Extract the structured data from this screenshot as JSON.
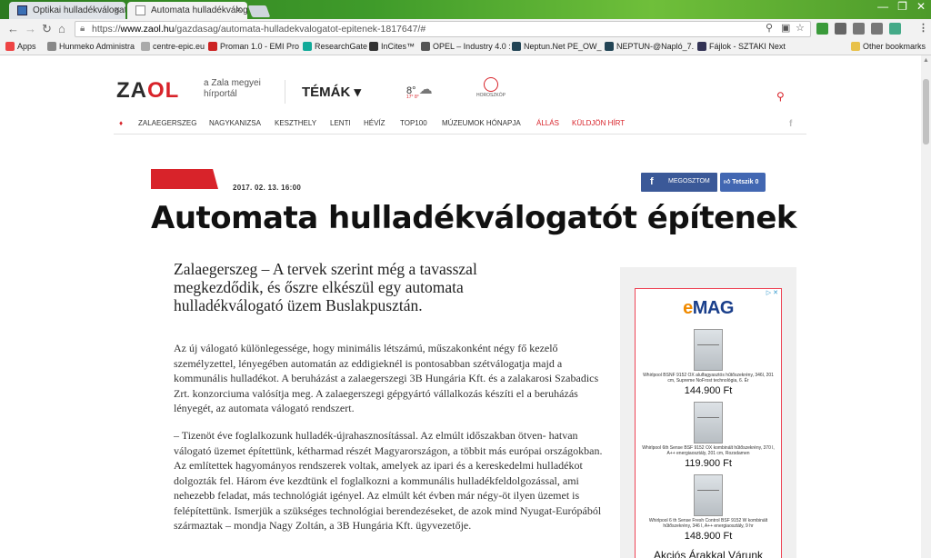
{
  "browser": {
    "tabs": [
      {
        "title": "Optikai hulladékválogató",
        "active": false
      },
      {
        "title": "Automata hulladékválogató",
        "active": true
      }
    ],
    "url_prefix": "https://",
    "url_host": "www.zaol.hu",
    "url_path": "/gazdasag/automata-hulladekvalogatot-epitenek-1817647/#",
    "bookmarks": [
      "Apps",
      "Hunmeko Administra",
      "centre-epic.eu",
      "Proman 1.0 - EMI Pro",
      "ResearchGate",
      "InCites™",
      "OPEL – Industry 4.0 :",
      "Neptun.Net PE_OW_",
      "NEPTUN-@Napló_7.",
      "Fájlok - SZTAKI Next",
      "Other bookmarks"
    ]
  },
  "site": {
    "logo_main": "ZA",
    "logo_accent": "OL",
    "tagline": "a Zala megyei hírportál",
    "topics_label": "TÉMÁK ▾",
    "temperature": "8°",
    "temp_range": "17° 8°",
    "horoscope_label": "HOROSZKÓP",
    "nav": [
      {
        "label": "ZALAEGERSZEG",
        "hot": false
      },
      {
        "label": "NAGYKANIZSA",
        "hot": false
      },
      {
        "label": "KESZTHELY",
        "hot": false
      },
      {
        "label": "LENTI",
        "hot": false
      },
      {
        "label": "HÉVÍZ",
        "hot": false
      },
      {
        "label": "TOP100",
        "hot": false
      },
      {
        "label": "MÚZEUMOK HÓNAPJA",
        "hot": false
      },
      {
        "label": "ÁLLÁS",
        "hot": true
      },
      {
        "label": "KÜLDJÖN HÍRT",
        "hot": true
      }
    ]
  },
  "article": {
    "date": "2017. 02. 13. 16:00",
    "share_label": "MEGOSZTOM",
    "like_label": "Tetszik 0",
    "title": "Automata hulladékválogatót építenek",
    "lead": "Zalaegerszeg – A tervek szerint még a tavasszal megkezdődik, és őszre elkészül egy automata hulladékválogató üzem Buslakpusztán.",
    "paragraphs": [
      "Az új válogató különlegessége, hogy minimális létszámú, műszakonként négy fő kezelő személyzettel, lényegében automatán az eddigieknél is pontosabban szétválogatja majd a kommunális hulladékot. A beruházást a zalaegerszegi 3B Hungária Kft. és a zalakarosi Szabadics Zrt. konzorciuma valósítja meg. A zalaegerszegi gépgyártó vállalkozás készíti el a beruházás lényegét, az automata válogató rendszert.",
      "– Tizenöt éve foglalkozunk hulladék-újrahasznosítással. Az elmúlt időszakban ötven- hatvan válogató üzemet építettünk, kétharmad részét Magyarországon, a többit más európai országokban. Az említettek hagyományos rendszerek voltak, amelyek az ipari és a kereskedelmi hulladékot dolgozták fel. Három éve kezdtünk el foglalkozni a kommunális hulladékfeldolgozással, ami nehezebb feladat, más technológiát igényel. Az elmúlt két évben már négy-öt ilyen üzemet is felépítettünk. Ismerjük a szükséges technológiai berendezéseket, de azok mind Nyugat-Európából származtak – mondja Nagy Zoltán, a 3B Hungária Kft. ügyvezetője."
    ]
  },
  "ad": {
    "brand_e": "e",
    "brand_rest": "MAG",
    "products": [
      {
        "desc": "Whirlpool BSNF 9152 OX alulfagyasztós hűtőszekrény, 346l, 201 cm, Supreme NoFrost technológia, 6. Ér",
        "price": "144.900 Ft"
      },
      {
        "desc": "Whirlpool 6th Sense BSF 9152 OX kombinált hűtőszekrény, 370 l, A++ energiaosztály, 201 cm, Rozsdamen",
        "price": "119.900 Ft"
      },
      {
        "desc": "Whirlpool 6 th Sense Fresh Control BSF 9152 W kombinált hűtőszekrény, 346 l, A++ energiaosztály, 9 hr",
        "price": "148.900 Ft"
      }
    ],
    "footer": "Akciós Árakkal Várunk"
  }
}
